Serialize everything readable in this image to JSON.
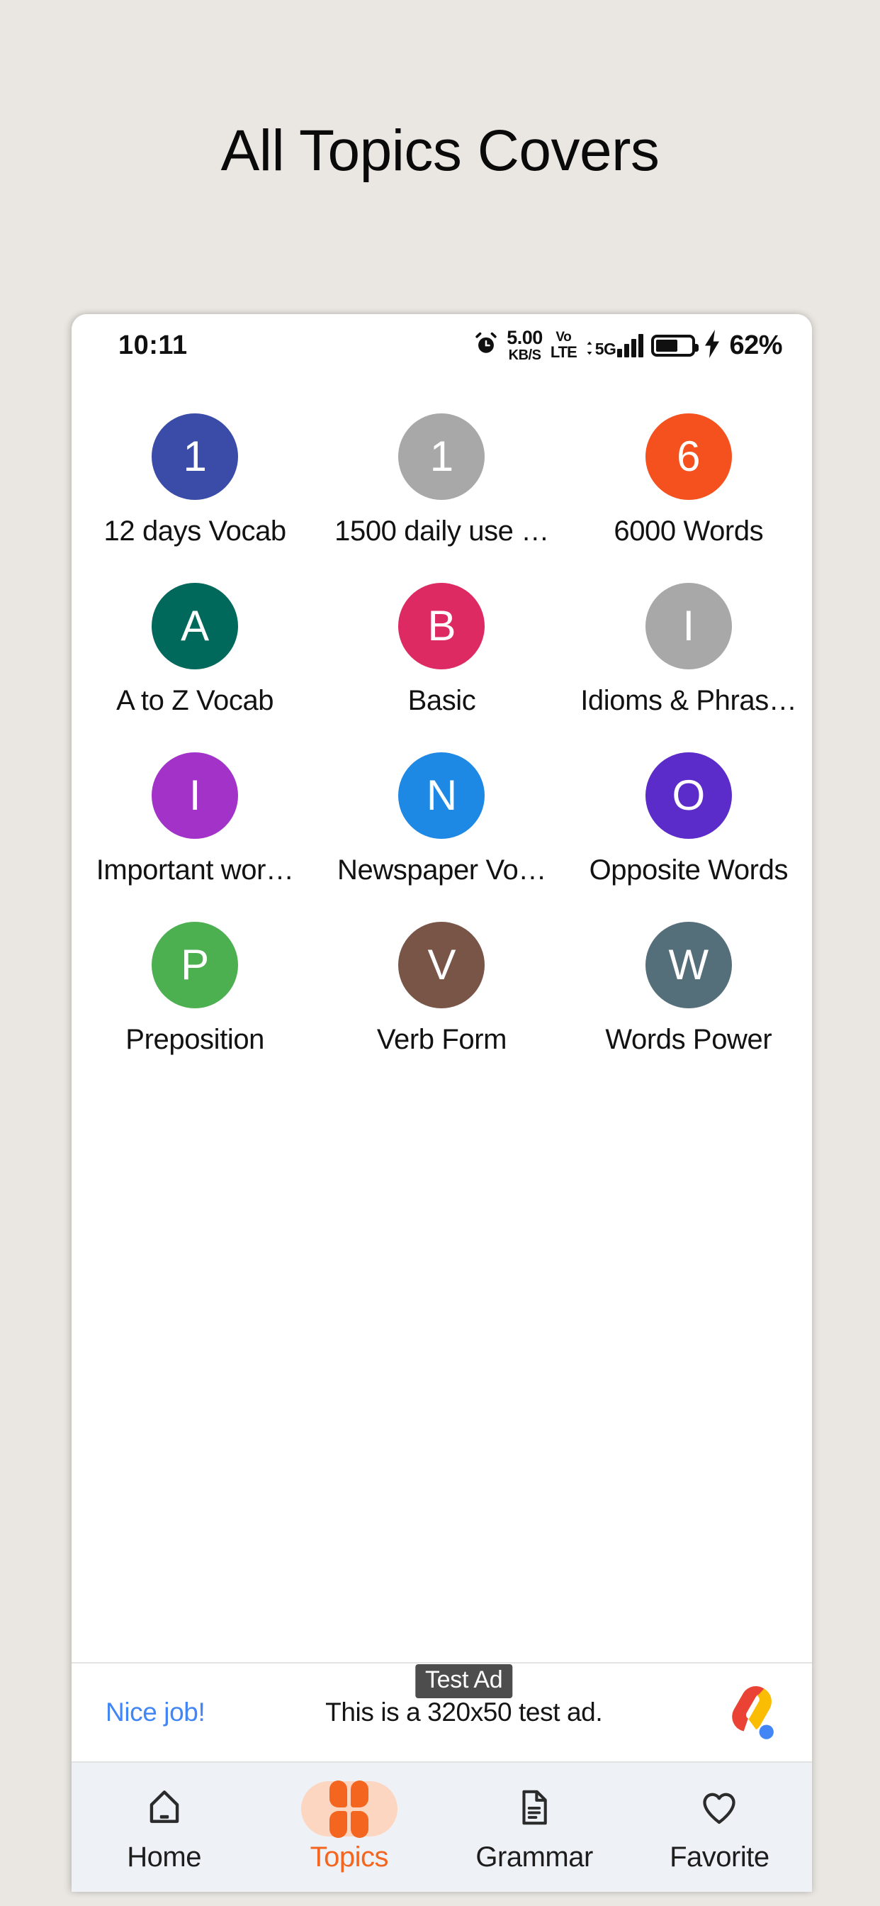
{
  "page": {
    "title": "All Topics Covers",
    "background_color": "#eae7e2"
  },
  "statusbar": {
    "time": "10:11",
    "alarm_icon": "alarm-clock-icon",
    "network_speed_value": "5.00",
    "network_speed_unit": "KB/S",
    "volte_top": "Vo",
    "volte_bottom": "LTE",
    "network_type": "5G",
    "signal_icon": "signal-bars-icon",
    "battery_icon": "battery-icon",
    "charging_icon": "lightning-bolt-icon",
    "battery_percent": "62%"
  },
  "topics": {
    "items": [
      {
        "initial": "1",
        "label": "12 days Vocab",
        "color": "#3b4ba8"
      },
      {
        "initial": "1",
        "label": "1500 daily use …",
        "color": "#a8a8a8"
      },
      {
        "initial": "6",
        "label": "6000 Words",
        "color": "#f4511e"
      },
      {
        "initial": "A",
        "label": "A to Z Vocab",
        "color": "#00695c"
      },
      {
        "initial": "B",
        "label": "Basic",
        "color": "#de2a63"
      },
      {
        "initial": "I",
        "label": "Idioms & Phras…",
        "color": "#a8a8a8"
      },
      {
        "initial": "I",
        "label": "Important wor…",
        "color": "#a333c8"
      },
      {
        "initial": "N",
        "label": "Newspaper Vo…",
        "color": "#1e88e5"
      },
      {
        "initial": "O",
        "label": "Opposite Words",
        "color": "#5b2cc9"
      },
      {
        "initial": "P",
        "label": "Preposition",
        "color": "#4caf50"
      },
      {
        "initial": "V",
        "label": "Verb Form",
        "color": "#795548"
      },
      {
        "initial": "W",
        "label": "Words Power",
        "color": "#546e7a"
      }
    ]
  },
  "ad": {
    "cta": "Nice job!",
    "badge": "Test Ad",
    "body": "This is a 320x50 test ad.",
    "logo_icon": "admob-logo-icon",
    "cta_color": "#4285f4"
  },
  "bottom_nav": {
    "accent_color": "#f4651f",
    "items": [
      {
        "label": "Home",
        "icon": "home-icon",
        "active": false
      },
      {
        "label": "Topics",
        "icon": "grid-petals-icon",
        "active": true
      },
      {
        "label": "Grammar",
        "icon": "document-icon",
        "active": false
      },
      {
        "label": "Favorite",
        "icon": "heart-icon",
        "active": false
      }
    ]
  }
}
